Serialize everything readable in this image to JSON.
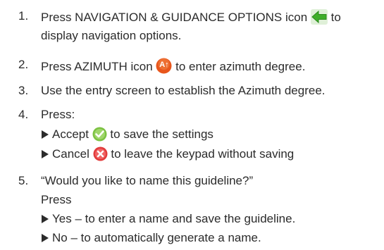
{
  "steps": [
    {
      "num": "1.",
      "line1_before": "Press NAVIGATION & GUIDANCE OPTIONS icon ",
      "line1_after": " to",
      "line2": "display navigation options.",
      "icon": "green-left-arrow-icon"
    },
    {
      "num": "2.",
      "before": "Press AZIMUTH icon ",
      "icon_text": "A↑",
      "after": " to enter azimuth degree.",
      "icon": "azimuth-icon"
    },
    {
      "num": "3.",
      "text": "Use the entry screen to establish the Azimuth degree."
    },
    {
      "num": "4.",
      "text": "Press:",
      "options": [
        {
          "label": "Accept ",
          "after": " to save the settings",
          "icon": "checkmark-icon"
        },
        {
          "label": "Cancel ",
          "after": " to leave the keypad without saving",
          "icon": "cancel-x-icon"
        }
      ]
    },
    {
      "num": "5.",
      "text": "“Would you like to name this guideline?”",
      "text2": "Press",
      "options": [
        {
          "text": "Yes – to enter a name and save the guideline."
        },
        {
          "text": "No – to automatically generate a name."
        }
      ]
    }
  ],
  "colors": {
    "text": "#2b2b2b",
    "arrow_green": "#3fae2a",
    "azimuth_orange": "#e8561c",
    "accept_green": "#7cc242",
    "cancel_red": "#e23b3b"
  }
}
